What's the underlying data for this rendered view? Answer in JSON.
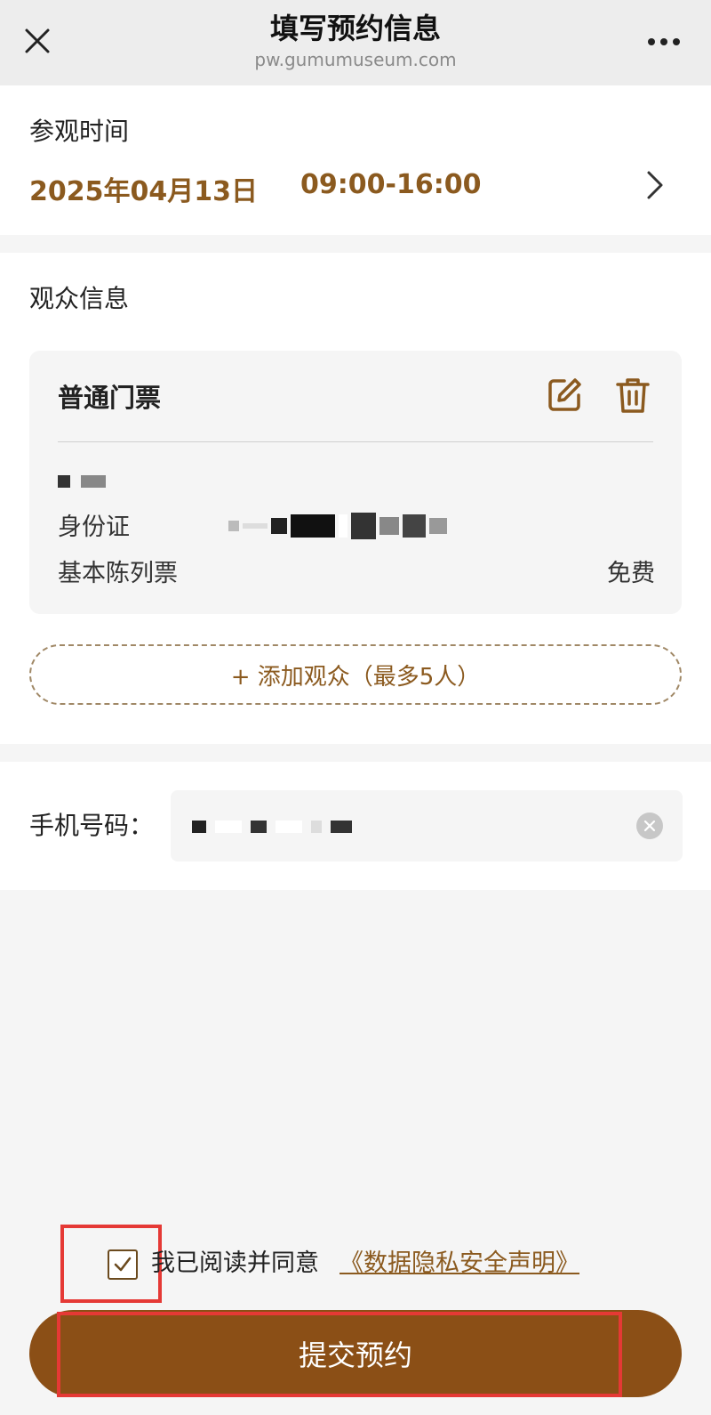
{
  "header": {
    "title": "填写预约信息",
    "url": "pw.gumumuseum.com"
  },
  "visit": {
    "label": "参观时间",
    "date": "2025年04月13日",
    "time": "09:00-16:00"
  },
  "visitors": {
    "label": "观众信息",
    "ticket": {
      "title": "普通门票",
      "id_label": "身份证",
      "type_label": "基本陈列票",
      "price": "免费"
    },
    "add_label": "+ 添加观众（最多5人）"
  },
  "phone": {
    "label": "手机号码："
  },
  "agreement": {
    "text": "我已阅读并同意",
    "link": "《数据隐私安全声明》",
    "checked": true
  },
  "submit": {
    "label": "提交预约"
  },
  "colors": {
    "accent": "#8b5a1f",
    "button": "#8b4f16",
    "highlight": "#e53935"
  },
  "icons": {
    "close": "close-icon",
    "more": "more-icon",
    "chevron": "chevron-right-icon",
    "edit": "edit-icon",
    "delete": "trash-icon",
    "clear": "clear-icon",
    "check": "check-icon"
  }
}
